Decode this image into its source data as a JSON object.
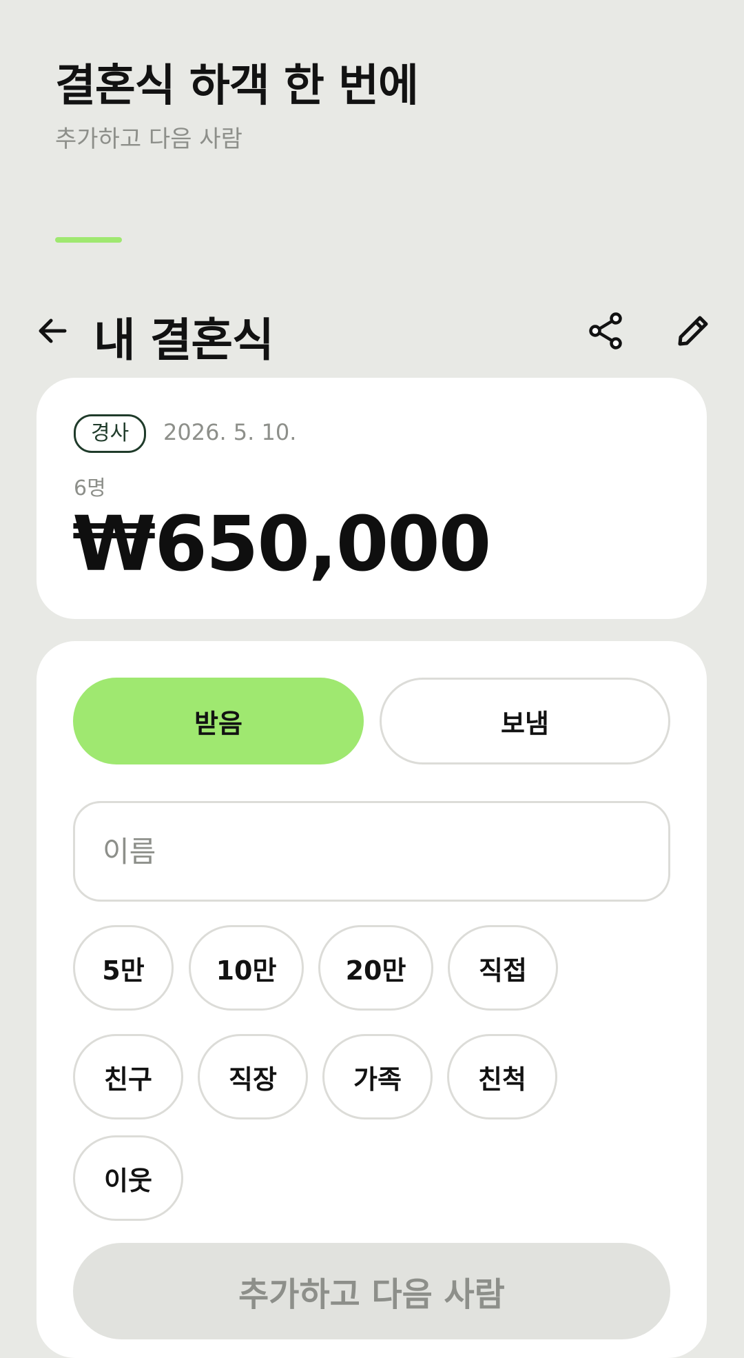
{
  "promo": {
    "title": "결혼식 하객 한 번에",
    "subtitle": "추가하고 다음 사람",
    "accent_color": "#9fe870"
  },
  "header": {
    "title": "내 결혼식",
    "back_icon": "arrow-left-icon",
    "share_icon": "share-icon",
    "edit_icon": "pencil-icon"
  },
  "summary": {
    "tag": "경사",
    "date": "2026. 5. 10.",
    "guest_count": "6명",
    "total": "₩650,000"
  },
  "form": {
    "toggle": {
      "received_label": "받음",
      "sent_label": "보냄",
      "selected": "받음"
    },
    "name_placeholder": "이름",
    "name_value": "",
    "amount_chips": [
      "5만",
      "10만",
      "20만",
      "직접"
    ],
    "relation_chips": [
      "친구",
      "직장",
      "가족",
      "친척",
      "이웃"
    ],
    "submit_label": "추가하고 다음 사람"
  },
  "colors": {
    "background": "#e8e9e5",
    "card": "#ffffff",
    "accent": "#9fe870",
    "tag_border": "#1f3b2a",
    "muted_text": "#8d8f8a",
    "disabled_button": "#e1e2de"
  }
}
